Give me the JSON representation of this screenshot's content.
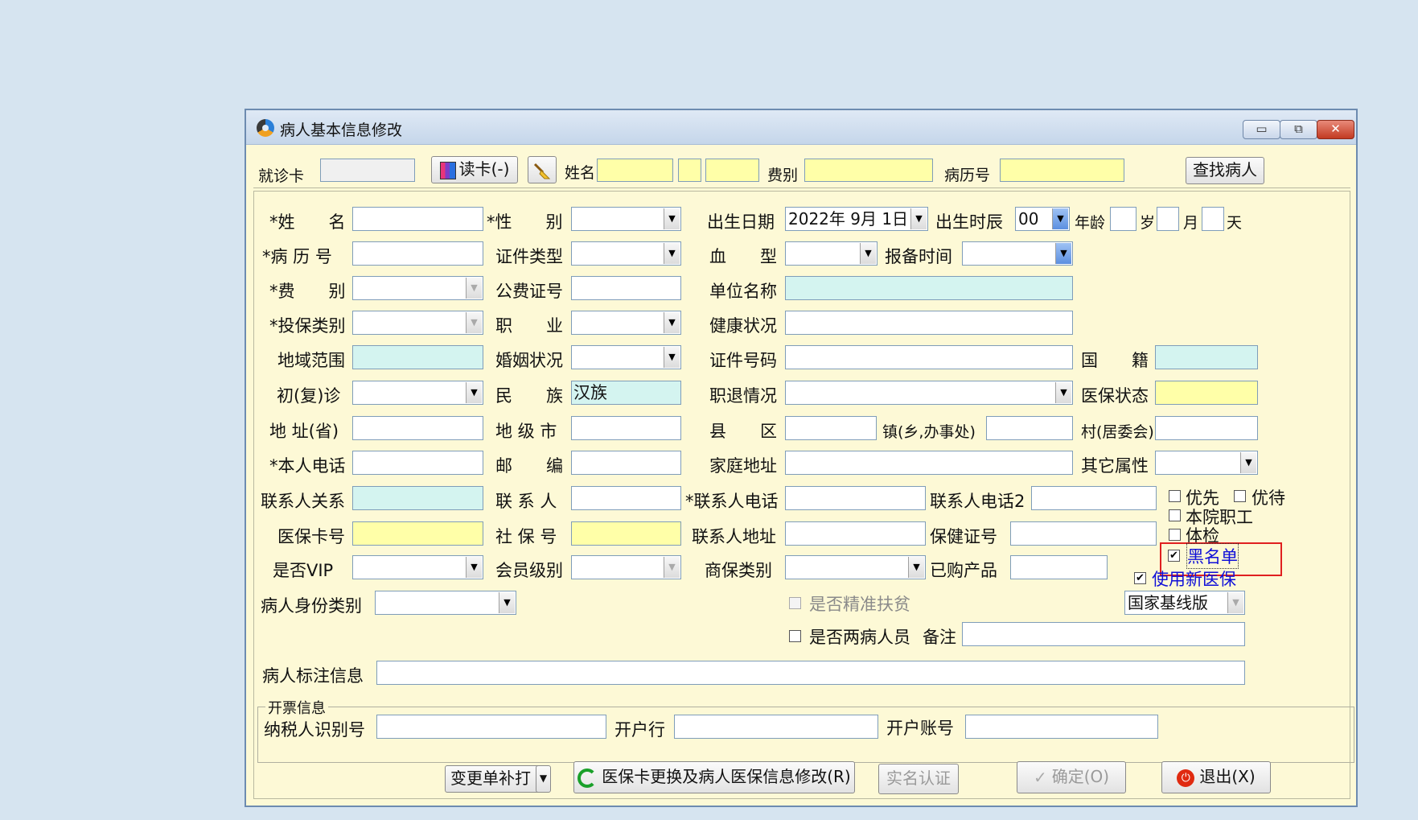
{
  "window": {
    "title": "病人基本信息修改",
    "buttons": {
      "minimize": "▭",
      "restore": "⧉",
      "close": "✕"
    }
  },
  "topbar": {
    "card_label": "就诊卡",
    "read_card_label": "读卡(-)",
    "name_label": "姓名",
    "fee_label": "费别",
    "record_label": "病历号",
    "find_button": "查找病人"
  },
  "form": {
    "name_label": "*姓　　名",
    "gender_label": "*性　　别",
    "birth_label": "出生日期",
    "birth_value": "2022年 9月 1日",
    "birth_hour_label": "出生时辰",
    "birth_hour_value": "00",
    "age_label": "年龄",
    "age_year_unit": "岁",
    "age_month_unit": "月",
    "age_day_unit": "天",
    "record_label": "*病 历 号",
    "id_type_label": "证件类型",
    "blood_label": "血　　型",
    "report_time_label": "报备时间",
    "fee_label": "*费　　别",
    "public_fee_label": "公费证号",
    "company_label": "单位名称",
    "insurance_type_label": "*投保类别",
    "job_label": "职　　业",
    "health_label": "健康状况",
    "region_label": "地域范围",
    "marriage_label": "婚姻状况",
    "id_number_label": "证件号码",
    "nationality_label": "国　　籍",
    "visit_type_label": "初(复)诊",
    "ethnic_label": "民　　族",
    "ethnic_value": "汉族",
    "retire_label": "职退情况",
    "insurance_status_label": "医保状态",
    "province_label": "地 址(省)",
    "city_label": "地 级 市",
    "county_label": "县　　区",
    "town_label": "镇(乡,办事处)",
    "village_label": "村(居委会)",
    "phone_label": "*本人电话",
    "postcode_label": "邮　　编",
    "home_address_label": "家庭地址",
    "other_attr_label": "其它属性",
    "contact_relation_label": "联系人关系",
    "contact_label": "联 系 人",
    "contact_phone_label": "*联系人电话",
    "contact_phone2_label": "联系人电话2",
    "medical_card_label": "医保卡号",
    "social_security_label": "社 保 号",
    "contact_address_label": "联系人地址",
    "health_card_label": "保健证号",
    "vip_label": "是否VIP",
    "member_level_label": "会员级别",
    "commercial_insurance_label": "商保类别",
    "purchased_label": "已购产品",
    "identity_type_label": "病人身份类别",
    "poverty_label": "是否精准扶贫",
    "two_disease_label": "是否两病人员",
    "remark_label": "备注",
    "note_label": "病人标注信息",
    "version_value": "国家基线版"
  },
  "checkboxes": {
    "priority": "优先",
    "preferential": "优待",
    "staff": "本院职工",
    "checkup": "体检",
    "blacklist": "黑名单",
    "new_insurance": "使用新医保"
  },
  "invoice": {
    "group_title": "开票信息",
    "taxpayer_label": "纳税人识别号",
    "bank_label": "开户行",
    "account_label": "开户账号"
  },
  "footer": {
    "reprint_label": "变更单补打",
    "update_insurance_label": "医保卡更换及病人医保信息修改(R)",
    "verify_label": "实名认证",
    "confirm_label": "确定(O)",
    "exit_label": "退出(X)"
  }
}
